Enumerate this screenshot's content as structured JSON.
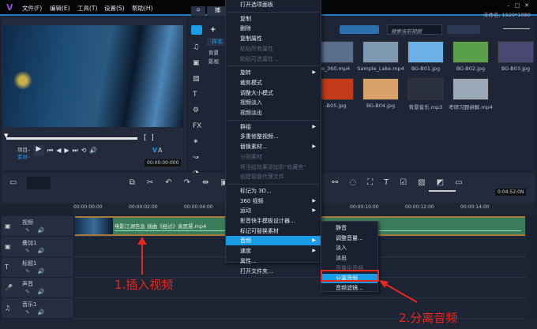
{
  "titlebar": {
    "menus": [
      "文件(F)",
      "编辑(E)",
      "工具(T)",
      "设置(S)",
      "帮助(H)"
    ],
    "project": "未命名, 1920*1080",
    "home_tab": "⌂",
    "tab": "捕"
  },
  "preview": {
    "mode_project": "项目–",
    "mode_clip": "素材–",
    "timecode": "00:00:00:000",
    "v": "V",
    "a": "A"
  },
  "library": {
    "add": "+",
    "sample": "样本",
    "tree": [
      "背景",
      "影视"
    ],
    "search_placeholder": "搜索当前视图",
    "items": [
      {
        "name": "e_360.mp4",
        "c": "#5a6e8e"
      },
      {
        "name": "Sample_Lake.mp4",
        "c": "#7f98b2"
      },
      {
        "name": "BG-B01.jpg",
        "c": "#6cb0e8"
      },
      {
        "name": "BG-B02.jpg",
        "c": "#5aa04a"
      },
      {
        "name": "BG-B03.jpg",
        "c": "#4a4870"
      },
      {
        "name": "-B05.jpg",
        "c": "#c23a18"
      },
      {
        "name": "BG-B04.jpg",
        "c": "#d7a26a"
      },
      {
        "name": "背景音乐.mp3",
        "c": "#2a3040"
      },
      {
        "name": "考研习题讲解.mp4",
        "c": "#9aa8b8"
      }
    ]
  },
  "timeline": {
    "ruler": [
      "00:00:00:00",
      "00:00:02:00",
      "00:00:04:00",
      "00:00:10:00",
      "00:00:12:00",
      "00:00:14:00"
    ],
    "duration": "0:04:52:0N",
    "tracks": [
      "视频",
      "叠加1",
      "标题1",
      "声音",
      "音乐1"
    ],
    "clip_name": "电影江湖告急 插曲《经过》袁思慧.mp4"
  },
  "context_menu": [
    {
      "label": "打开选项面板"
    },
    {
      "sep": true
    },
    {
      "label": "复制"
    },
    {
      "label": "删除"
    },
    {
      "label": "复制属性"
    },
    {
      "label": "粘贴所有属性",
      "disabled": true
    },
    {
      "label": "粘贴可选属性...",
      "disabled": true
    },
    {
      "sep": true
    },
    {
      "label": "旋转",
      "sub": true
    },
    {
      "label": "裁剪模式"
    },
    {
      "label": "调整大小模式"
    },
    {
      "label": "视频淡入"
    },
    {
      "label": "视频淡出"
    },
    {
      "sep": true
    },
    {
      "label": "群组",
      "sub": true
    },
    {
      "label": "多重修整视频..."
    },
    {
      "label": "替换素材...",
      "sub": true
    },
    {
      "label": "分割素材",
      "disabled": true
    },
    {
      "label": "将当前效果添加到\"收藏夹\"",
      "disabled": true
    },
    {
      "label": "创建智能代理文件",
      "disabled": true
    },
    {
      "sep": true
    },
    {
      "label": "标记为 3D..."
    },
    {
      "label": "360 视频",
      "sub": true
    },
    {
      "label": "运动",
      "sub": true
    },
    {
      "label": "影音快手模板设计器..."
    },
    {
      "label": "标记可替换素材"
    },
    {
      "label": "音频",
      "sub": true,
      "highlight": true
    },
    {
      "label": "速度",
      "sub": true
    },
    {
      "label": "属性..."
    },
    {
      "label": "打开文件夹..."
    }
  ],
  "audio_submenu": [
    {
      "label": "静音"
    },
    {
      "label": "调整音量..."
    },
    {
      "label": "淡入"
    },
    {
      "label": "淡出"
    },
    {
      "label": "音量化音频",
      "disabled": true
    },
    {
      "label": "分离音频",
      "highlight": true
    },
    {
      "label": "音频滤镜..."
    }
  ],
  "annotations": {
    "step1": "1.插入视频",
    "step2": "2.分离音频",
    "color": "#e8281e"
  }
}
